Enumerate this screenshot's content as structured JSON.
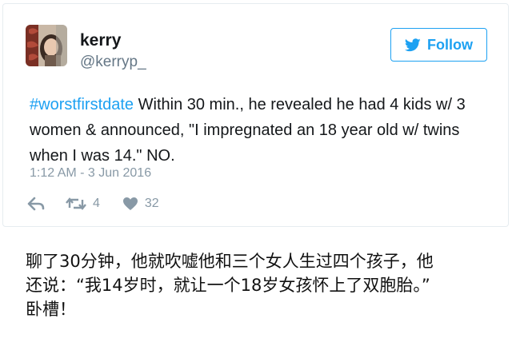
{
  "tweet": {
    "author": {
      "display_name": "kerry",
      "handle": "@kerryp_",
      "avatar_icon": "profile-photo-icon"
    },
    "follow_button": {
      "label": "Follow",
      "icon": "twitter-bird-icon",
      "color": "#1da1f2"
    },
    "text": {
      "hashtag": "#worstfirstdate",
      "body": " Within 30 min., he revealed he had 4 kids w/ 3 women & announced, \"I impregnated an 18 year old w/ twins when I was 14.\" NO."
    },
    "timestamp": "1:12 AM - 3 Jun 2016",
    "actions": {
      "reply_icon": "reply-icon",
      "retweet_icon": "retweet-icon",
      "retweet_count": "4",
      "like_icon": "heart-icon",
      "like_count": "32"
    }
  },
  "caption": {
    "line1": "聊了30分钟，他就吹嘘他和三个女人生过四个孩子，他",
    "line2": "还说：“我14岁时，就让一个18岁女孩怀上了双胞胎。”",
    "line3": "卧槽！"
  }
}
